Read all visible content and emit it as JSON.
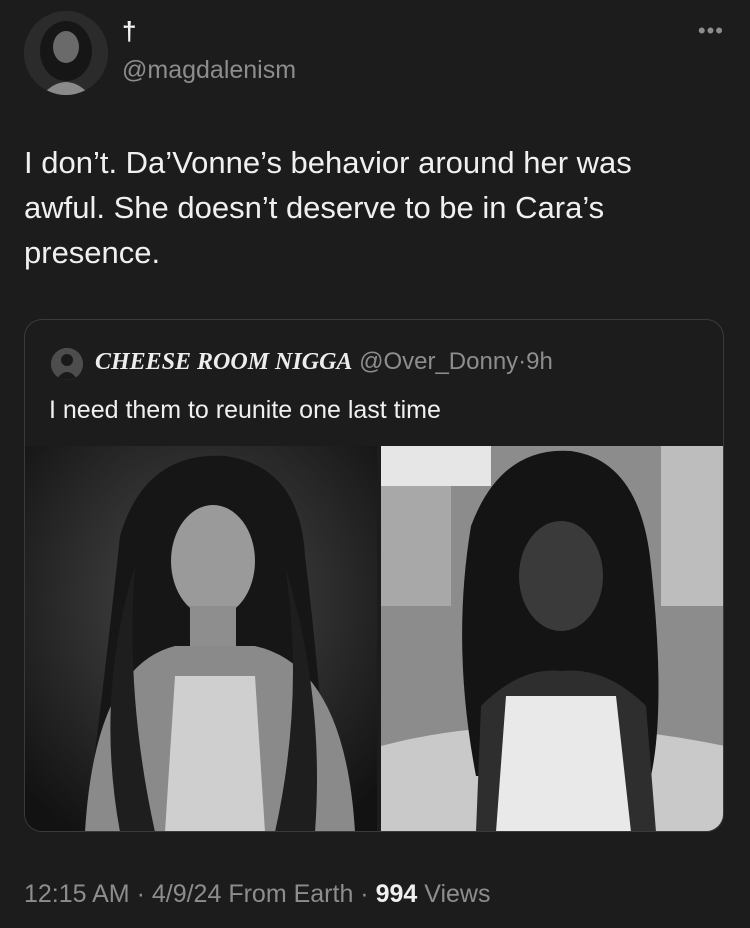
{
  "author": {
    "display_name": "†",
    "handle": "@magdalenism",
    "avatar_icon": "profile-photo"
  },
  "menu_icon": "more-options-icon",
  "tweet": {
    "text": "I don’t. Da’Vonne’s behavior around her was awful. She doesn’t deserve to be in Cara’s presence."
  },
  "quoted": {
    "display_name": "CHEESE ROOM NIGGA",
    "handle": "@Over_Donny",
    "separator": "·",
    "time": "9h",
    "text": "I need them to reunite one last time",
    "images": [
      "portrait-photo-left",
      "portrait-photo-right"
    ]
  },
  "footer": {
    "time": "12:15 AM",
    "date": "4/9/24",
    "source": "From Earth",
    "views_count": "994",
    "views_label": "Views"
  }
}
